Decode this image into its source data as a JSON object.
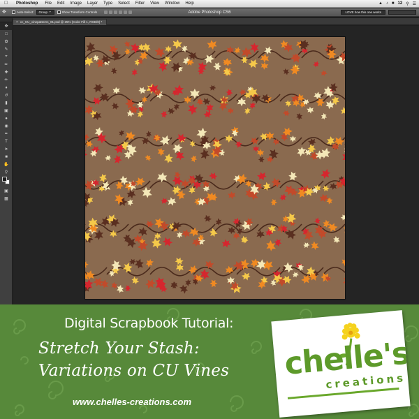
{
  "menubar": {
    "apple_icon": "apple-icon",
    "app_name": "Photoshop",
    "items": [
      "File",
      "Edit",
      "Image",
      "Layer",
      "Type",
      "Select",
      "Filter",
      "View",
      "Window",
      "Help"
    ],
    "status": {
      "badge": "12",
      "clock": ""
    }
  },
  "window": {
    "title": "Adobe Photoshop CS6"
  },
  "options_bar": {
    "auto_select_label": "Auto-Select:",
    "auto_select_value": "Group",
    "transform_label": "Show Transform Controls",
    "workspace_label": "LOVE how this one works"
  },
  "document": {
    "tab_label": "cc_CU_vinepatterns_01.psd @ 25% (Color Fill 1, RGB/8) *"
  },
  "tools": [
    "move-tool-icon",
    "marquee-tool-icon",
    "lasso-tool-icon",
    "quick-select-tool-icon",
    "crop-tool-icon",
    "eyedropper-tool-icon",
    "healing-brush-icon",
    "brush-tool-icon",
    "clone-stamp-icon",
    "history-brush-icon",
    "eraser-tool-icon",
    "gradient-tool-icon",
    "blur-tool-icon",
    "dodge-tool-icon",
    "pen-tool-icon",
    "type-tool-icon",
    "path-select-icon",
    "shape-tool-icon",
    "hand-tool-icon",
    "zoom-tool-icon"
  ],
  "colors": {
    "canvas_bg": "#8a6a4f",
    "leaf": [
      "#d6262e",
      "#f08a22",
      "#f5c94a",
      "#f4e8b8",
      "#5a2f20",
      "#c24a2a"
    ],
    "vine": "#4a2a1c",
    "banner_green": "#57893a"
  },
  "banner": {
    "tagline": "Digital Scrapbook Tutorial:",
    "headline_1": "Stretch Your Stash:",
    "headline_2": "Variations on CU Vines",
    "url": "www.chelles-creations.com"
  },
  "logo": {
    "word": "chelle's",
    "subword": "creations",
    "flower_icon": "dandelion-icon"
  }
}
